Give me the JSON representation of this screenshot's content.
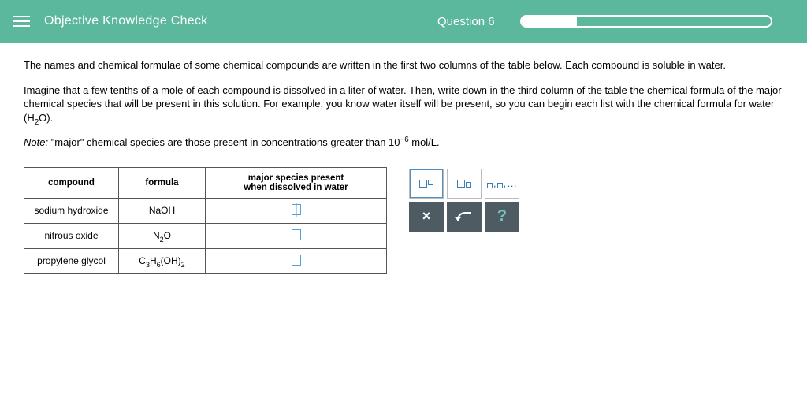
{
  "header": {
    "title": "Objective Knowledge Check",
    "question_label": "Question 6",
    "progress_percent": 22
  },
  "instructions": {
    "p1": "The names and chemical formulae of some chemical compounds are written in the first two columns of the table below. Each compound is soluble in water.",
    "p2_a": "Imagine that a few tenths of a mole of each compound is dissolved in a liter of water. Then, write down in the third column of the table the chemical formula of the major chemical species that will be present in this solution. For example, you know water itself will be present, so you can begin each list with the chemical formula for water (H",
    "p2_sub": "2",
    "p2_b": "O).",
    "note_label": "Note:",
    "note_a": " \"major\" chemical species are those present in concentrations greater than 10",
    "note_sup": "−6",
    "note_b": " mol/L."
  },
  "table": {
    "head_compound": "compound",
    "head_formula": "formula",
    "head_major": "major species present\nwhen dissolved in water",
    "rows": [
      {
        "name": "sodium hydroxide",
        "formula": "NaOH"
      },
      {
        "name": "nitrous oxide",
        "formula_a": "N",
        "formula_sub": "2",
        "formula_b": "O"
      },
      {
        "name": "propylene glycol",
        "formula_a": "C",
        "formula_sub1": "3",
        "formula_b": "H",
        "formula_sub2": "6",
        "formula_c": "(OH)",
        "formula_sub3": "2"
      }
    ]
  },
  "toolbox": {
    "more": "…",
    "close_label": "×",
    "help_label": "?"
  }
}
